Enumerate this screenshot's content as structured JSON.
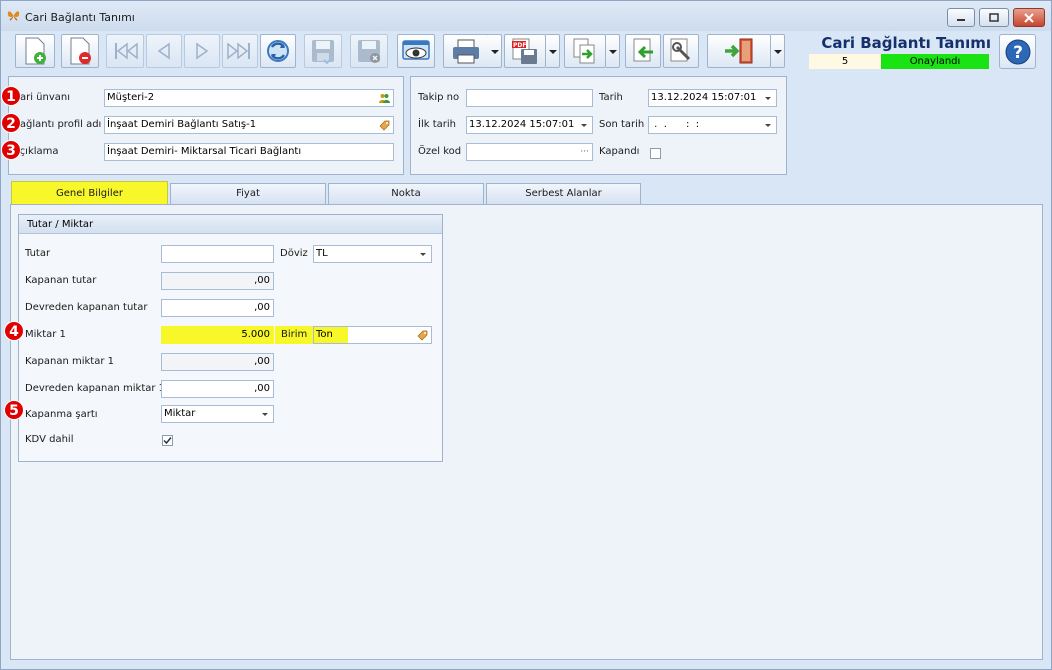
{
  "window": {
    "title": "Cari Bağlantı Tanımı",
    "controls": [
      "minimize",
      "maximize",
      "close"
    ]
  },
  "toolbar": {
    "buttons": [
      {
        "name": "new-icon",
        "enabled": true
      },
      {
        "name": "delete-icon",
        "enabled": true
      },
      {
        "name": "first-icon",
        "enabled": false
      },
      {
        "name": "previous-icon",
        "enabled": false
      },
      {
        "name": "next-icon",
        "enabled": false
      },
      {
        "name": "last-icon",
        "enabled": false
      },
      {
        "name": "refresh-icon",
        "enabled": true
      },
      {
        "name": "save-icon",
        "enabled": false
      },
      {
        "name": "cancel-save-icon",
        "enabled": false
      },
      {
        "name": "preview-icon",
        "enabled": true
      },
      {
        "name": "print-icon",
        "enabled": true
      },
      {
        "name": "pdf-export-icon",
        "enabled": true
      },
      {
        "name": "export-icon",
        "enabled": true
      },
      {
        "name": "import-icon",
        "enabled": true
      },
      {
        "name": "tools-icon",
        "enabled": true
      },
      {
        "name": "exit-icon",
        "enabled": true
      }
    ]
  },
  "header": {
    "title": "Cari Bağlantı Tanımı",
    "record_no": "5",
    "status": "Onaylandı",
    "status_color": "#19e312"
  },
  "form_left": {
    "cari_unvani": {
      "label": "Cari ünvanı",
      "value": "Müşteri-2",
      "badge": "1"
    },
    "baglanti_profil": {
      "label": "Bağlantı profil adı",
      "value": "İnşaat Demiri Bağlantı Satış-1",
      "badge": "2"
    },
    "aciklama": {
      "label": "Açıklama",
      "value": "İnşaat Demiri- Miktarsal Ticari Bağlantı",
      "badge": "3"
    }
  },
  "form_right": {
    "takip_no": {
      "label": "Takip no",
      "value": ""
    },
    "tarih": {
      "label": "Tarih",
      "value": "13.12.2024 15:07:01"
    },
    "ilk_tarih": {
      "label": "İlk tarih",
      "value": "13.12.2024 15:07:01"
    },
    "son_tarih": {
      "label": "Son tarih",
      "value": " .  .      :  :"
    },
    "ozel_kod": {
      "label": "Özel kod",
      "value": ""
    },
    "kapandi": {
      "label": "Kapandı",
      "checked": false
    }
  },
  "tabs": [
    {
      "label": "Genel Bilgiler",
      "active": true
    },
    {
      "label": "Fiyat",
      "active": false
    },
    {
      "label": "Nokta",
      "active": false
    },
    {
      "label": "Serbest Alanlar",
      "active": false
    }
  ],
  "group": {
    "title": "Tutar / Miktar",
    "tutar": {
      "label": "Tutar",
      "value": ""
    },
    "doviz": {
      "label": "Döviz",
      "value": "TL"
    },
    "kapanan_tutar": {
      "label": "Kapanan tutar",
      "value": ",00"
    },
    "devreden_kapanan_tutar": {
      "label": "Devreden kapanan tutar",
      "value": ",00"
    },
    "miktar1": {
      "label": "Miktar 1",
      "value": "5.000",
      "badge": "4"
    },
    "birim": {
      "label": "Birim",
      "value": "Ton"
    },
    "kapanan_miktar1": {
      "label": "Kapanan miktar 1",
      "value": ",00"
    },
    "devreden_kapanan_miktar1": {
      "label": "Devreden kapanan miktar 1",
      "value": ",00"
    },
    "kapanma_sarti": {
      "label": "Kapanma şartı",
      "value": "Miktar",
      "badge": "5"
    },
    "kdv_dahil": {
      "label": "KDV dahil",
      "checked": true
    }
  },
  "colors": {
    "highlight": "#f7f72a",
    "badge": "#e00000",
    "title": "#15306b"
  }
}
